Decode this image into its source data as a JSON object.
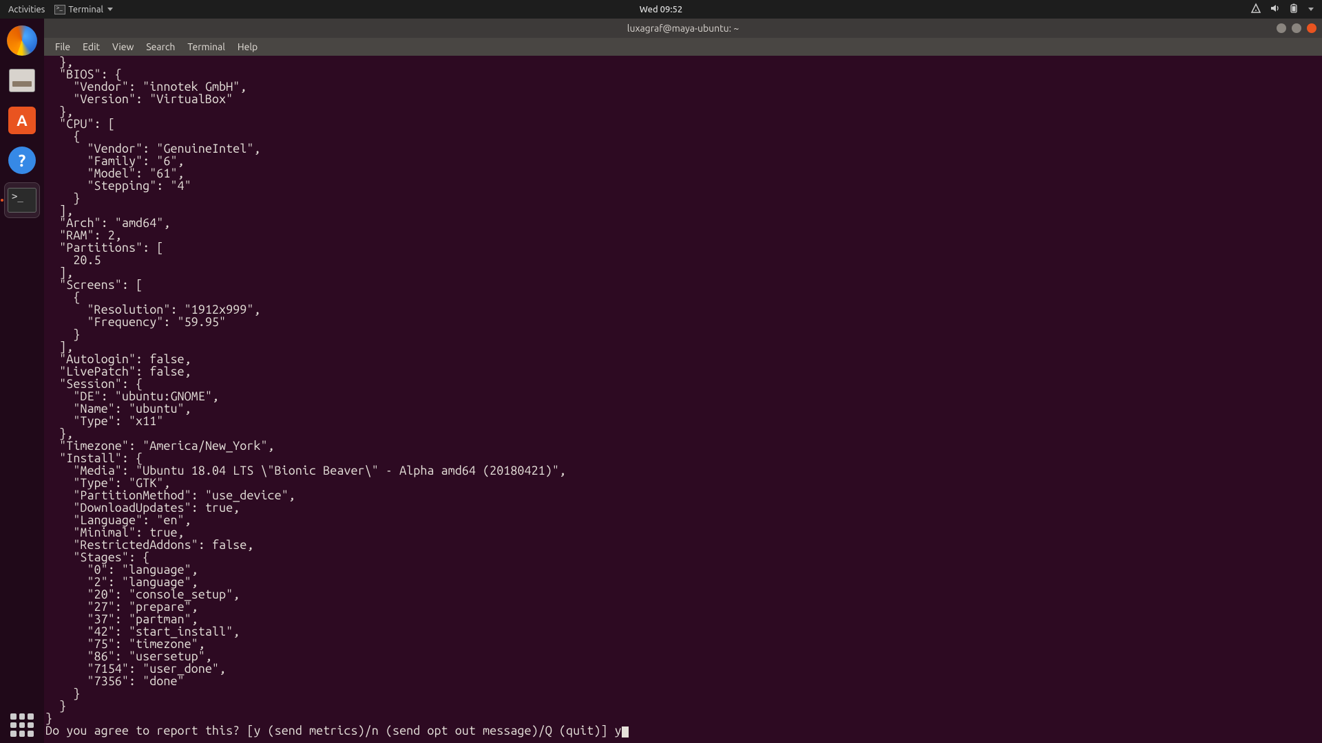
{
  "topbar": {
    "activities": "Activities",
    "app_name": "Terminal",
    "clock": "Wed 09:52"
  },
  "window": {
    "title": "luxagraf@maya-ubuntu: ~"
  },
  "menubar": {
    "file": "File",
    "edit": "Edit",
    "view": "View",
    "search": "Search",
    "terminal": "Terminal",
    "help": "Help"
  },
  "terminal": {
    "lines": [
      "  },",
      "  \"BIOS\": {",
      "    \"Vendor\": \"innotek GmbH\",",
      "    \"Version\": \"VirtualBox\"",
      "  },",
      "  \"CPU\": [",
      "    {",
      "      \"Vendor\": \"GenuineIntel\",",
      "      \"Family\": \"6\",",
      "      \"Model\": \"61\",",
      "      \"Stepping\": \"4\"",
      "    }",
      "  ],",
      "  \"Arch\": \"amd64\",",
      "  \"RAM\": 2,",
      "  \"Partitions\": [",
      "    20.5",
      "  ],",
      "  \"Screens\": [",
      "    {",
      "      \"Resolution\": \"1912x999\",",
      "      \"Frequency\": \"59.95\"",
      "    }",
      "  ],",
      "  \"Autologin\": false,",
      "  \"LivePatch\": false,",
      "  \"Session\": {",
      "    \"DE\": \"ubuntu:GNOME\",",
      "    \"Name\": \"ubuntu\",",
      "    \"Type\": \"x11\"",
      "  },",
      "  \"Timezone\": \"America/New_York\",",
      "  \"Install\": {",
      "    \"Media\": \"Ubuntu 18.04 LTS \\\"Bionic Beaver\\\" - Alpha amd64 (20180421)\",",
      "    \"Type\": \"GTK\",",
      "    \"PartitionMethod\": \"use_device\",",
      "    \"DownloadUpdates\": true,",
      "    \"Language\": \"en\",",
      "    \"Minimal\": true,",
      "    \"RestrictedAddons\": false,",
      "    \"Stages\": {",
      "      \"0\": \"language\",",
      "      \"2\": \"language\",",
      "      \"20\": \"console_setup\",",
      "      \"27\": \"prepare\",",
      "      \"37\": \"partman\",",
      "      \"42\": \"start_install\",",
      "      \"75\": \"timezone\",",
      "      \"86\": \"usersetup\",",
      "      \"7154\": \"user_done\",",
      "      \"7356\": \"done\"",
      "    }",
      "  }",
      "}",
      "Do you agree to report this? [y (send metrics)/n (send opt out message)/Q (quit)] y"
    ]
  }
}
